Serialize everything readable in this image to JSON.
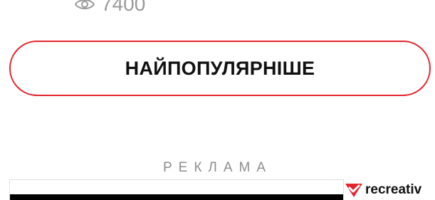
{
  "article": {
    "views_icon": "eye-icon",
    "views_count": "7400"
  },
  "popular_button": {
    "label": "НАЙПОПУЛЯРНІШЕ",
    "border_color": "#e4252c"
  },
  "advertisement": {
    "label": "РЕКЛАМА",
    "brand": "recreativ",
    "brand_icon": "recreativ-logo-icon",
    "brand_color": "#e4252c"
  }
}
